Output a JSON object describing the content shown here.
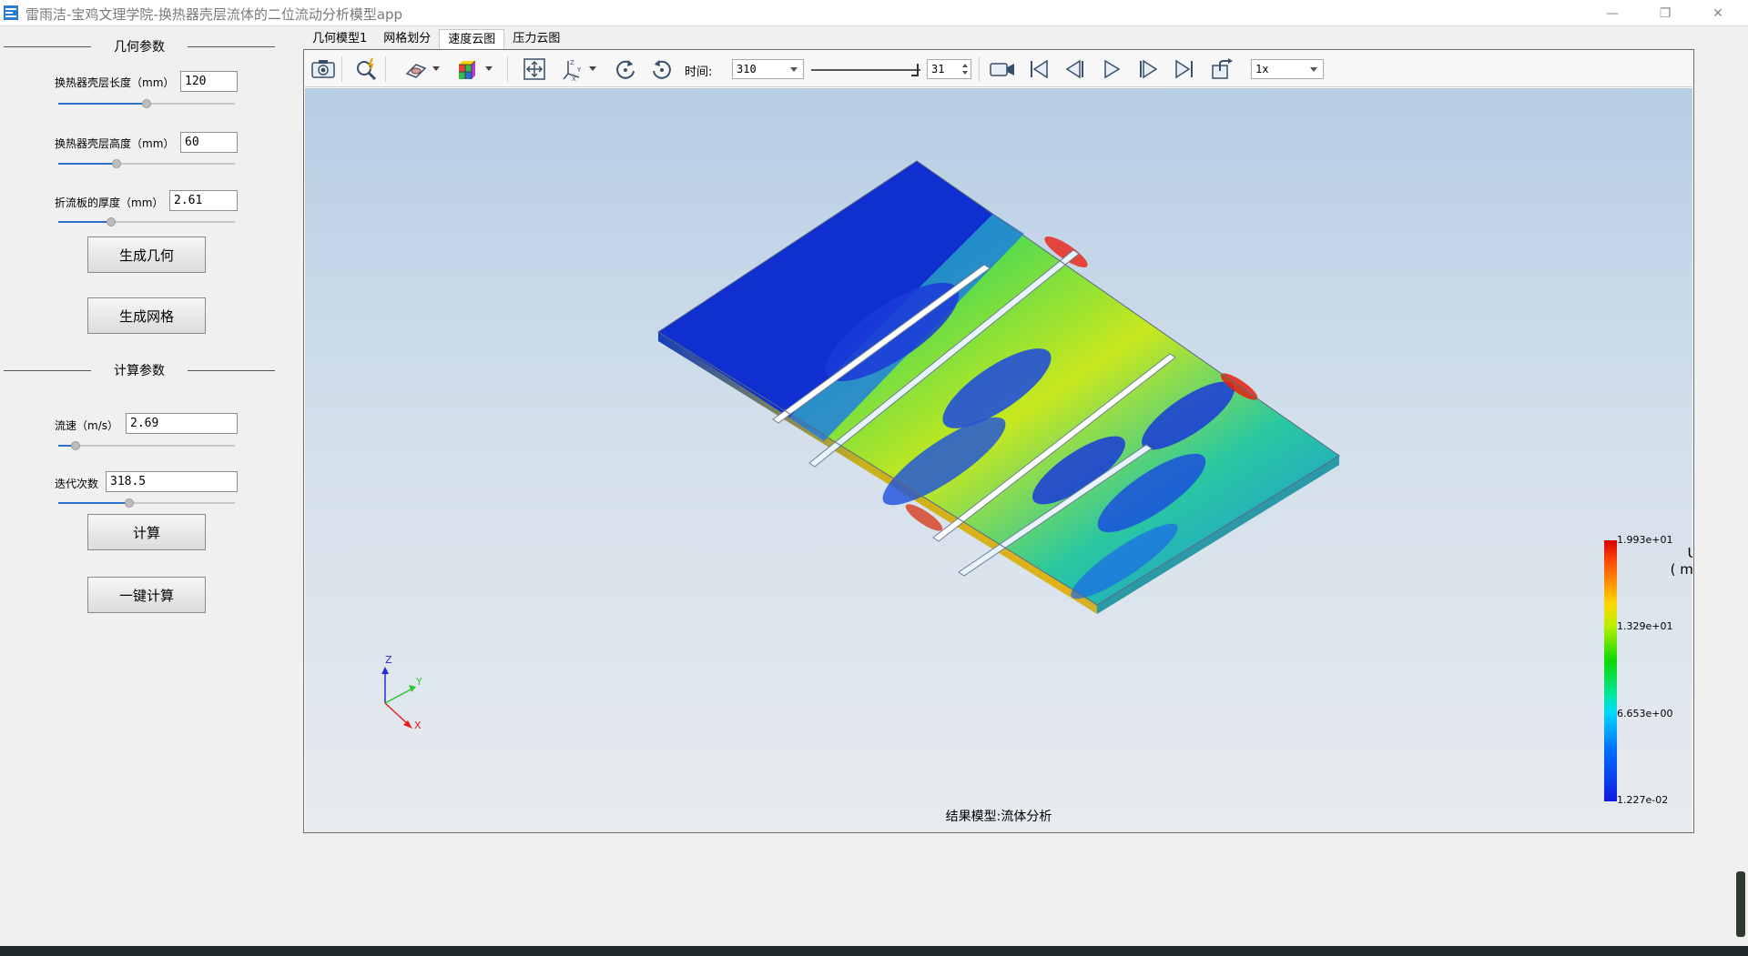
{
  "window": {
    "title": "雷雨洁-宝鸡文理学院-换热器壳层流体的二位流动分析模型app",
    "minimize_glyph": "—",
    "maximize_glyph": "❐",
    "close_glyph": "✕"
  },
  "geometry_section": {
    "title": "几何参数",
    "params": [
      {
        "label": "换热器壳层长度（mm）",
        "value": "120",
        "slider_fraction": 0.5
      },
      {
        "label": "换热器壳层高度（mm）",
        "value": "60",
        "slider_fraction": 0.33
      },
      {
        "label": "折流板的厚度（mm）",
        "value": "2.61",
        "slider_fraction": 0.3
      }
    ],
    "buttons": [
      "生成几何",
      "生成网格"
    ]
  },
  "compute_section": {
    "title": "计算参数",
    "params": [
      {
        "label": "流速（m/s）",
        "value": "2.69",
        "slider_fraction": 0.1
      },
      {
        "label": "迭代次数",
        "value": "318.5",
        "slider_fraction": 0.4
      }
    ],
    "buttons": [
      "计算",
      "一键计算"
    ]
  },
  "tabs": [
    {
      "label": "几何模型1",
      "active": false
    },
    {
      "label": "网格划分",
      "active": false
    },
    {
      "label": "速度云图",
      "active": true
    },
    {
      "label": "压力云图",
      "active": false
    }
  ],
  "toolbar": {
    "time_label": "时间:",
    "time_value": "310",
    "frame_value": "31",
    "speed_value": "1x"
  },
  "viewer": {
    "caption": "结果模型:流体分析",
    "axes": {
      "z": "Z",
      "y": "Y",
      "x": "X"
    }
  },
  "legend": {
    "variable": "U",
    "unit": "( m/s )",
    "ticks": [
      "1.993e+01",
      "1.329e+01",
      "6.653e+00",
      "1.227e-02"
    ],
    "colors": [
      "#d80000",
      "#ffd500",
      "#10d800",
      "#00d8ff",
      "#0f1adf"
    ]
  }
}
